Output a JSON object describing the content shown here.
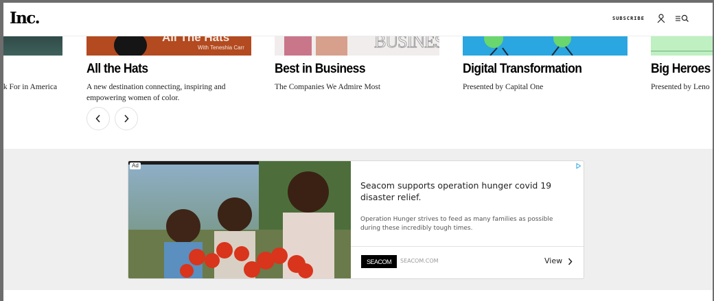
{
  "header": {
    "logo": "Inc.",
    "subscribe_label": "SUBSCRIBE",
    "user_icon": "user-icon",
    "menu_search_icon": "menu-search-icon"
  },
  "carousel": {
    "cards": [
      {
        "title": "",
        "description": "rk For in America"
      },
      {
        "title": "All the Hats",
        "description": "A new destination connecting, inspiring and empowering women of color.",
        "thumb_text": "All The Hats",
        "thumb_subtext": "With Teneshia Carr"
      },
      {
        "title": "Best in Business",
        "description": "The Companies We Admire Most",
        "thumb_text": "BUSINESS"
      },
      {
        "title": "Digital Transformation",
        "description": "Presented by Capital One"
      },
      {
        "title": "Big Heroes",
        "description": "Presented by Leno"
      }
    ],
    "prev_icon": "chevron-left-icon",
    "next_icon": "chevron-right-icon"
  },
  "ad": {
    "badge": "Ad",
    "headline": "Seacom supports operation hunger covid 19 disaster relief.",
    "body": "Operation Hunger strives to feed as many families as possible during these incredibly tough times.",
    "advertiser_logo": "SEACOM",
    "domain": "SEACOM.COM",
    "cta": "View",
    "adchoices_icon": "adchoices-icon"
  },
  "colors": {
    "band": "#efefef",
    "accent_blue": "#2aa6e0",
    "thumb_orange": "#b34a20"
  }
}
